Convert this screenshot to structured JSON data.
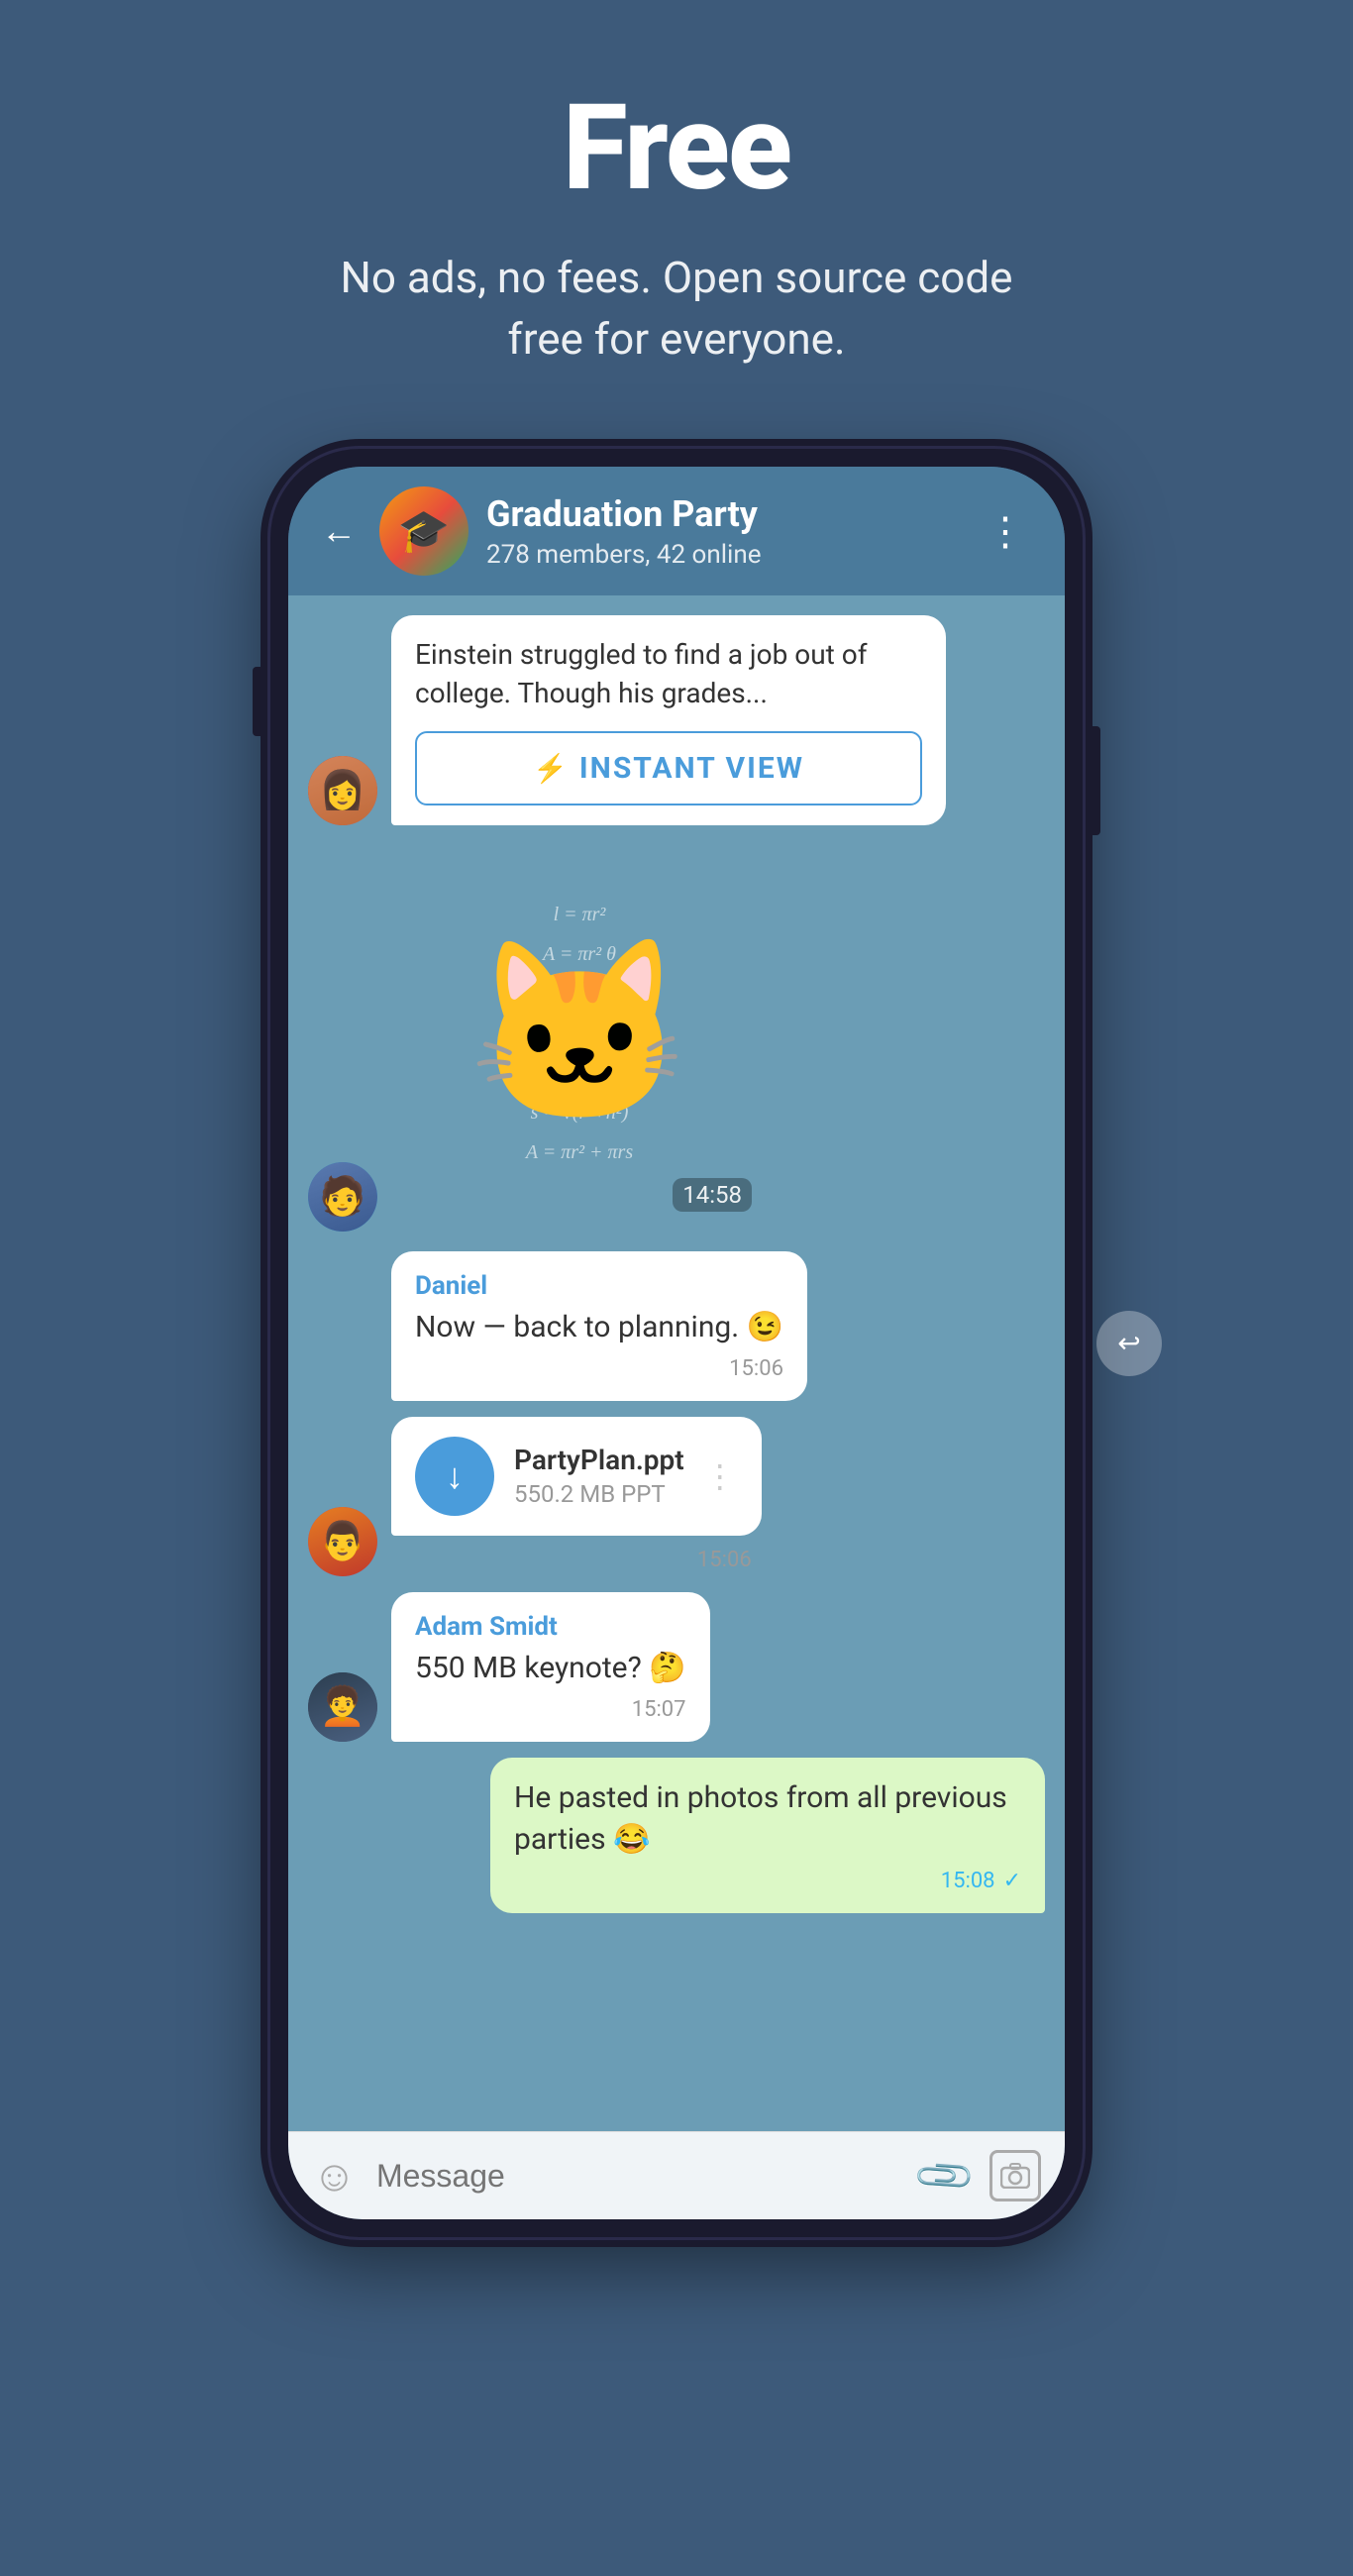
{
  "hero": {
    "title": "Free",
    "subtitle": "No ads, no fees. Open source code free for everyone."
  },
  "chat": {
    "header": {
      "back_label": "←",
      "group_name": "Graduation Party",
      "group_members": "278 members, 42 online",
      "more_label": "⋮"
    },
    "article": {
      "text": "Einstein struggled to find a job out of college. Though his grades...",
      "instant_view_label": "INSTANT VIEW"
    },
    "sticker": {
      "time": "14:58"
    },
    "messages": [
      {
        "sender": "Daniel",
        "text": "Now — back to planning. 😉",
        "time": "15:06",
        "type": "received"
      },
      {
        "filename": "PartyPlan.ppt",
        "filesize": "550.2 MB PPT",
        "time": "15:06",
        "type": "file"
      },
      {
        "sender": "Adam Smidt",
        "text": "550 MB keynote? 🤔",
        "time": "15:07",
        "type": "received"
      },
      {
        "text": "He pasted in photos from all previous parties 😂",
        "time": "15:08",
        "type": "sent",
        "check": "✓"
      }
    ],
    "input": {
      "placeholder": "Message"
    }
  }
}
